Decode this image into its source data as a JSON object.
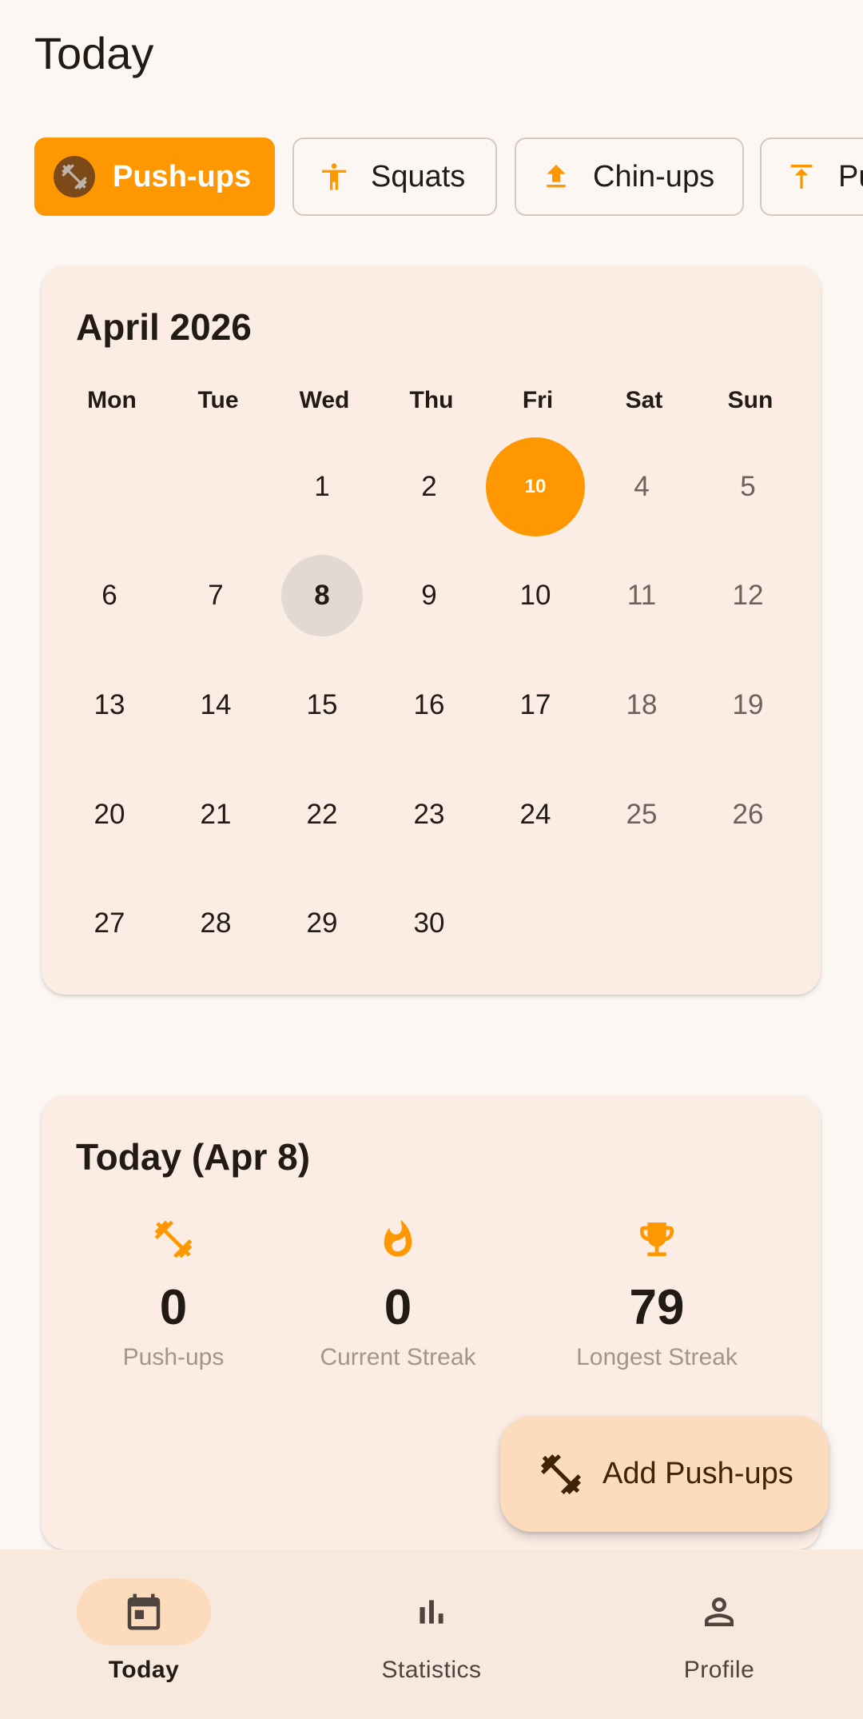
{
  "header": {
    "title": "Today"
  },
  "exercise_chips": [
    {
      "label": "Push-ups",
      "icon": "dumbbell-icon",
      "selected": true
    },
    {
      "label": "Squats",
      "icon": "person-standing-icon",
      "selected": false
    },
    {
      "label": "Chin-ups",
      "icon": "upload-arrow-icon",
      "selected": false
    },
    {
      "label": "Pu",
      "icon": "arrow-up-bar-icon",
      "selected": false
    }
  ],
  "calendar": {
    "month_title": "April 2026",
    "weekdays": [
      "Mon",
      "Tue",
      "Wed",
      "Thu",
      "Fri",
      "Sat",
      "Sun"
    ],
    "week1": [
      "",
      "",
      "1",
      "2",
      "10",
      "4",
      "5"
    ],
    "week2": [
      "6",
      "7",
      "8",
      "9",
      "10",
      "11",
      "12"
    ],
    "week3": [
      "13",
      "14",
      "15",
      "16",
      "17",
      "18",
      "19"
    ],
    "week4": [
      "20",
      "21",
      "22",
      "23",
      "24",
      "25",
      "26"
    ],
    "week5": [
      "27",
      "28",
      "29",
      "30",
      "",
      "",
      ""
    ]
  },
  "today_summary": {
    "title": "Today (Apr 8)",
    "stats": [
      {
        "value": "0",
        "label": "Push-ups",
        "icon": "dumbbell-icon"
      },
      {
        "value": "0",
        "label": "Current Streak",
        "icon": "flame-icon"
      },
      {
        "value": "79",
        "label": "Longest Streak",
        "icon": "trophy-icon"
      }
    ]
  },
  "fab": {
    "label": "Add Push-ups",
    "icon": "dumbbell-icon"
  },
  "bottom_nav": [
    {
      "label": "Today",
      "icon": "calendar-icon",
      "active": true
    },
    {
      "label": "Statistics",
      "icon": "bar-chart-icon",
      "active": false
    },
    {
      "label": "Profile",
      "icon": "person-icon",
      "active": false
    }
  ],
  "colors": {
    "accent": "#ff9800",
    "background": "#fdf7f3",
    "card": "#fcede4",
    "fab": "#fddcbe",
    "nav_bar": "#f8e9df",
    "today_marker": "#e2d9d2"
  }
}
